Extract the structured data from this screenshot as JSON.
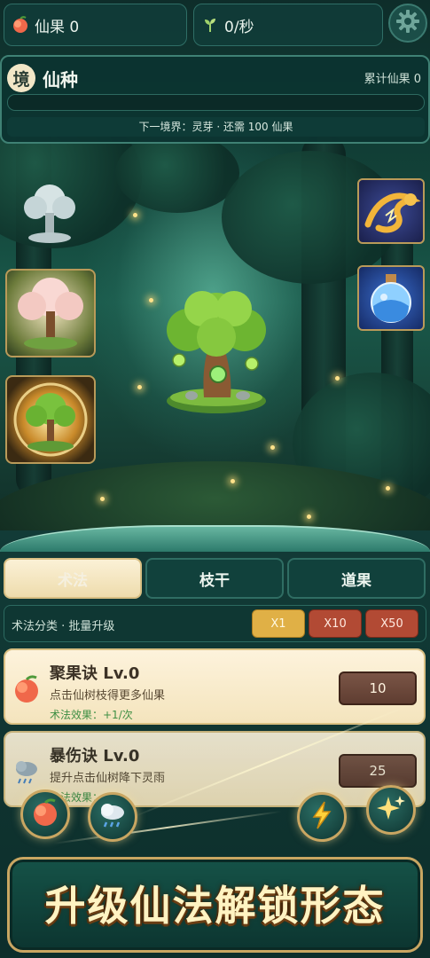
{
  "colors": {
    "accent_gold": "#c9a662",
    "panel_bg": "#123b37",
    "progress_fill": "#6fd39a",
    "multiplier_active": "#e0b046",
    "multiplier_idle": "#b24a34",
    "effect_green": "#3f8f44"
  },
  "top_bar": {
    "fruit_icon": "peach-icon",
    "fruit_label": "仙果 0",
    "rate_icon": "sprout-icon",
    "rate_label": "0/秒",
    "settings_icon": "gear-icon"
  },
  "realm": {
    "badge": "境",
    "name": "仙种",
    "total_label": "累计仙果 0",
    "progress": 0,
    "next_hint": "下一境界：灵芽 · 还需 100 仙果"
  },
  "scene": {
    "left_thumbnails": [
      "frost-tree-icon",
      "blossom-tree-icon",
      "glowing-tree-icon"
    ],
    "right_thumbnails": [
      "dragon-icon",
      "potion-icon"
    ],
    "main_tree_icon": "spirit-tree-icon"
  },
  "tabs": [
    {
      "label": "术法",
      "active": true
    },
    {
      "label": "枝干",
      "active": false
    },
    {
      "label": "道果",
      "active": false
    }
  ],
  "subbar": {
    "label": "术法分类 · 批量升级",
    "multipliers": [
      {
        "label": "X1",
        "active": true
      },
      {
        "label": "X10",
        "active": false
      },
      {
        "label": "X50",
        "active": false
      }
    ]
  },
  "skills": [
    {
      "icon": "peach-icon",
      "name": "聚果诀 Lv.0",
      "desc": "点击仙树枝得更多仙果",
      "effect": "术法效果：+1/次",
      "cost": "10"
    },
    {
      "icon": "rain-cloud-icon",
      "name": "暴伤诀 Lv.0",
      "desc": "提升点击仙树降下灵雨",
      "effect": "术法效果：",
      "cost": "25"
    }
  ],
  "float_buttons": [
    "peach-icon",
    "rain-cloud-icon",
    "lightning-icon",
    "sparkle-icon"
  ],
  "banner": {
    "text": "升级仙法解锁形态"
  }
}
